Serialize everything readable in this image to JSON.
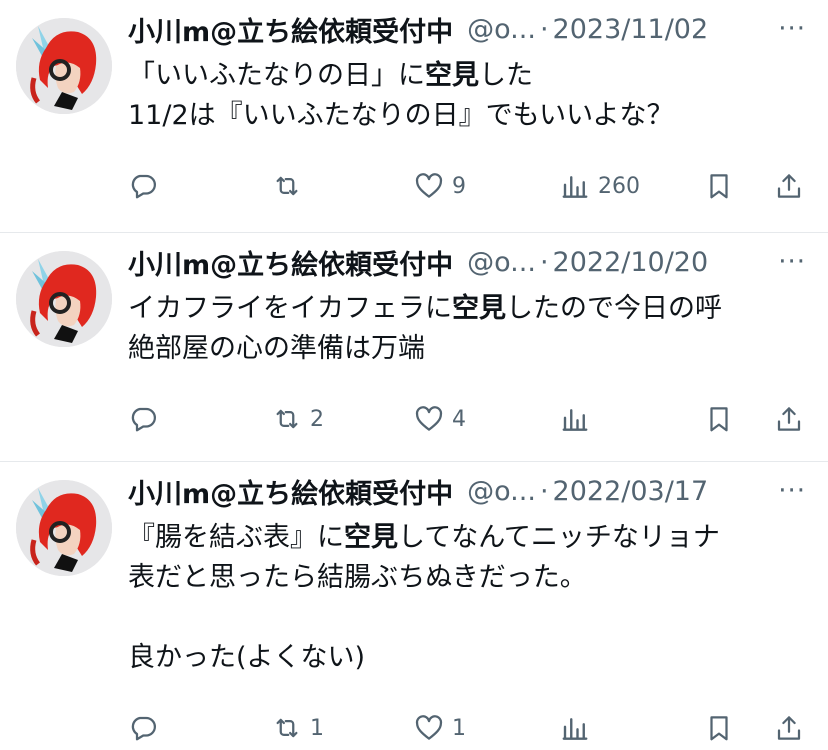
{
  "tweets": [
    {
      "name": "小川m@立ち絵依頼受付中",
      "handle": "@o...",
      "sep": "·",
      "date": "2023/11/02",
      "more": "···",
      "lines": [
        [
          {
            "t": "「いいふたなりの日」に",
            "b": false
          },
          {
            "t": "空見",
            "b": true
          },
          {
            "t": "した",
            "b": false
          }
        ],
        [
          {
            "t": "11/2は『いいふたなりの日』でもいいよな？",
            "b": false
          }
        ]
      ],
      "reply_count": "",
      "retweet_count": "",
      "like_count": "9",
      "view_count": "260"
    },
    {
      "name": "小川m@立ち絵依頼受付中",
      "handle": "@o...",
      "sep": "·",
      "date": "2022/10/20",
      "more": "···",
      "lines": [
        [
          {
            "t": "イカフライをイカフェラに",
            "b": false
          },
          {
            "t": "空見",
            "b": true
          },
          {
            "t": "したので今日の呼",
            "b": false
          }
        ],
        [
          {
            "t": "絶部屋の心の準備は万端",
            "b": false
          }
        ]
      ],
      "reply_count": "",
      "retweet_count": "2",
      "like_count": "4",
      "view_count": ""
    },
    {
      "name": "小川m@立ち絵依頼受付中",
      "handle": "@o...",
      "sep": "·",
      "date": "2022/03/17",
      "more": "···",
      "lines": [
        [
          {
            "t": "『腸を結ぶ表』に",
            "b": false
          },
          {
            "t": "空見",
            "b": true
          },
          {
            "t": "してなんてニッチなリョナ",
            "b": false
          }
        ],
        [
          {
            "t": "表だと思ったら結腸ぶちぬきだった。",
            "b": false
          }
        ],
        [
          {
            "t": "",
            "b": false
          }
        ],
        [
          {
            "t": "良かった(よくない)",
            "b": false
          }
        ]
      ],
      "reply_count": "",
      "retweet_count": "1",
      "like_count": "1",
      "view_count": ""
    }
  ],
  "icons": [
    "reply-icon",
    "retweet-icon",
    "like-icon",
    "views-icon",
    "bookmark-icon",
    "share-icon",
    "more-icon"
  ],
  "colors": {
    "text": "#0f1419",
    "secondary": "#536471",
    "divider": "#e6e9ec",
    "avatar_hair": "#e0281f",
    "avatar_bg": "#e8e8ea"
  }
}
